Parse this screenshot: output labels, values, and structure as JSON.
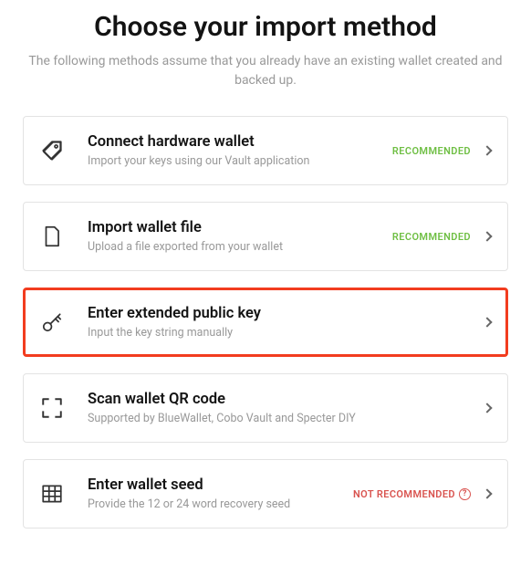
{
  "header": {
    "title": "Choose your import method",
    "subtitle": "The following methods assume that you already have an existing wallet created and backed up."
  },
  "badges": {
    "recommended": "RECOMMENDED",
    "not_recommended": "NOT RECOMMENDED",
    "help_symbol": "?"
  },
  "options": {
    "hardware": {
      "title": "Connect hardware wallet",
      "desc": "Import your keys using our Vault application"
    },
    "file": {
      "title": "Import wallet file",
      "desc": "Upload a file exported from your wallet"
    },
    "xpub": {
      "title": "Enter extended public key",
      "desc": "Input the key string manually"
    },
    "qr": {
      "title": "Scan wallet QR code",
      "desc": "Supported by BlueWallet, Cobo Vault and Specter DIY"
    },
    "seed": {
      "title": "Enter wallet seed",
      "desc": "Provide the 12 or 24 word recovery seed"
    }
  }
}
